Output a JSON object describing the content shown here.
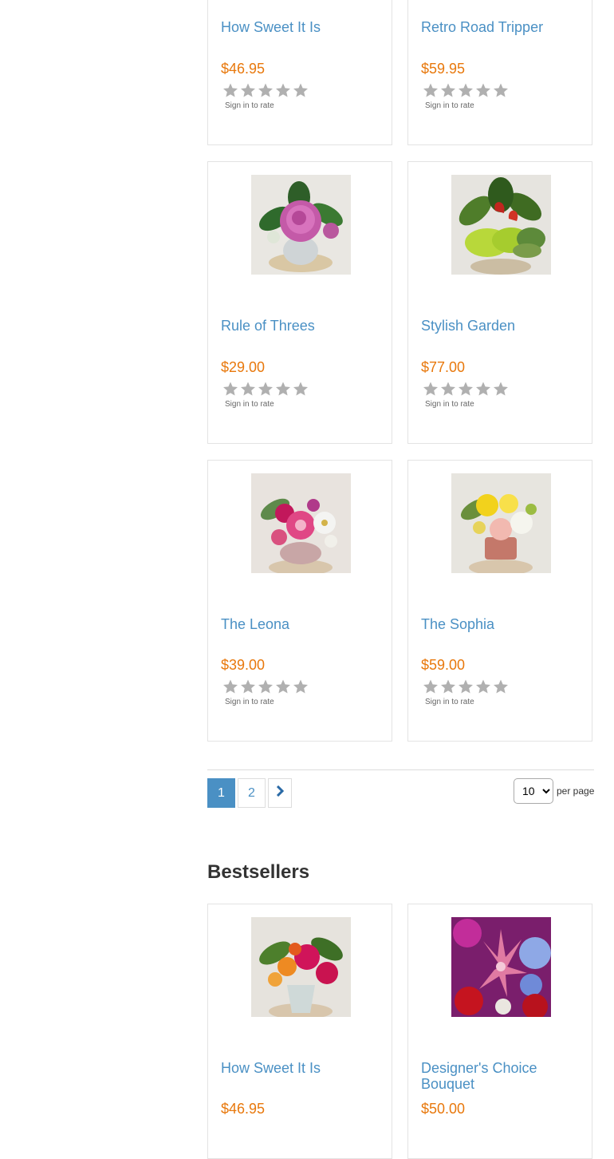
{
  "products": [
    {
      "title": "How Sweet It Is",
      "price": "$46.95",
      "rating_action": "Sign in to rate",
      "image": "bouquet-pink-orange"
    },
    {
      "title": "Retro Road Tripper",
      "price": "$59.95",
      "rating_action": "Sign in to rate",
      "image": "retro-arrangement"
    },
    {
      "title": "Rule of Threes",
      "price": "$29.00",
      "rating_action": "Sign in to rate",
      "image": "purple-roses"
    },
    {
      "title": "Stylish Garden",
      "price": "$77.00",
      "rating_action": "Sign in to rate",
      "image": "green-plants-anthurium"
    },
    {
      "title": "The Leona",
      "price": "$39.00",
      "rating_action": "Sign in to rate",
      "image": "pink-white-mix"
    },
    {
      "title": "The Sophia",
      "price": "$59.00",
      "rating_action": "Sign in to rate",
      "image": "yellow-white-carnations"
    }
  ],
  "pagination": {
    "pages": [
      "1",
      "2"
    ],
    "current": "1",
    "next_icon": "chevron-right-icon"
  },
  "per_page": {
    "selected": "10",
    "label": "per page"
  },
  "bestsellers": {
    "title": "Bestsellers",
    "products": [
      {
        "title": "How Sweet It Is",
        "price": "$46.95",
        "image": "bouquet-pink-orange"
      },
      {
        "title": "Designer's Choice Bouquet",
        "price": "$50.00",
        "image": "lily-rose-mix"
      }
    ]
  },
  "rating": {
    "max_stars": 5,
    "filled": 0,
    "star_color": "#b0b0b0"
  },
  "colors": {
    "link": "#4a90c4",
    "price": "#e8780c",
    "border": "#e3e3e3"
  }
}
